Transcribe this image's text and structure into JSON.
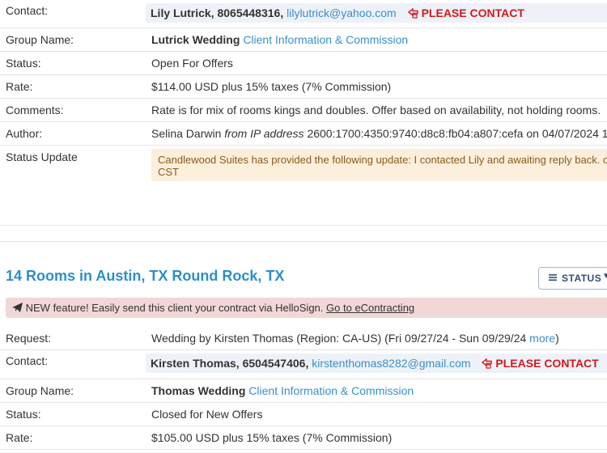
{
  "listing1": {
    "contact_label": "Contact:",
    "contact_name": "Lily Lutrick, 8065448316,",
    "contact_email": "lilylutrick@yahoo.com",
    "please_contact": "PLEASE CONTACT",
    "group_label": "Group Name:",
    "group_name": "Lutrick Wedding",
    "group_link": "Client Information & Commission",
    "status_label": "Status:",
    "status_value": "Open For Offers",
    "rate_label": "Rate:",
    "rate_value": "$114.00 USD plus 15% taxes (7% Commission)",
    "comments_label": "Comments:",
    "comments_value": "Rate is for mix of rooms kings and doubles. Offer based on availability, not holding rooms.",
    "author_label": "Author:",
    "author_name": "Selina Darwin",
    "author_from": "from IP address",
    "author_ip": "2600:1700:4350:9740:d8c8:fb04:a807:cefa on 04/07/2024 1",
    "update_label": "Status Update",
    "update_line1": "Candlewood Suites has provided the following update: I contacted Lily and awaiting reply back. o",
    "update_line2": "CST"
  },
  "listing2": {
    "title": "14 Rooms in  Austin, TX  Round Rock, TX",
    "status_button": "STATUS",
    "banner_text": "NEW feature! Easily send this client your contract via HelloSign.",
    "banner_link": "Go to eContracting",
    "request_label": "Request:",
    "request_value": "Wedding by Kirsten Thomas (Region: CA-US) (Fri 09/27/24 - Sun 09/29/24",
    "request_more": "more",
    "request_close": ")",
    "contact_label": "Contact:",
    "contact_name": "Kirsten Thomas, 6504547406,",
    "contact_email": "kirstenthomas8282@gmail.com",
    "please_contact": "PLEASE CONTACT",
    "group_label": "Group Name:",
    "group_name": "Thomas Wedding",
    "group_link": "Client Information & Commission",
    "status_label": "Status:",
    "status_value": "Closed for New Offers",
    "rate_label": "Rate:",
    "rate_value": "$105.00 USD plus 15% taxes (7% Commission)"
  },
  "colors": {
    "link": "#3a8fc8",
    "please": "#d2191e",
    "title": "#2b90c7",
    "update_bg": "#fcefdc",
    "banner_bg": "#f2d7d7"
  }
}
